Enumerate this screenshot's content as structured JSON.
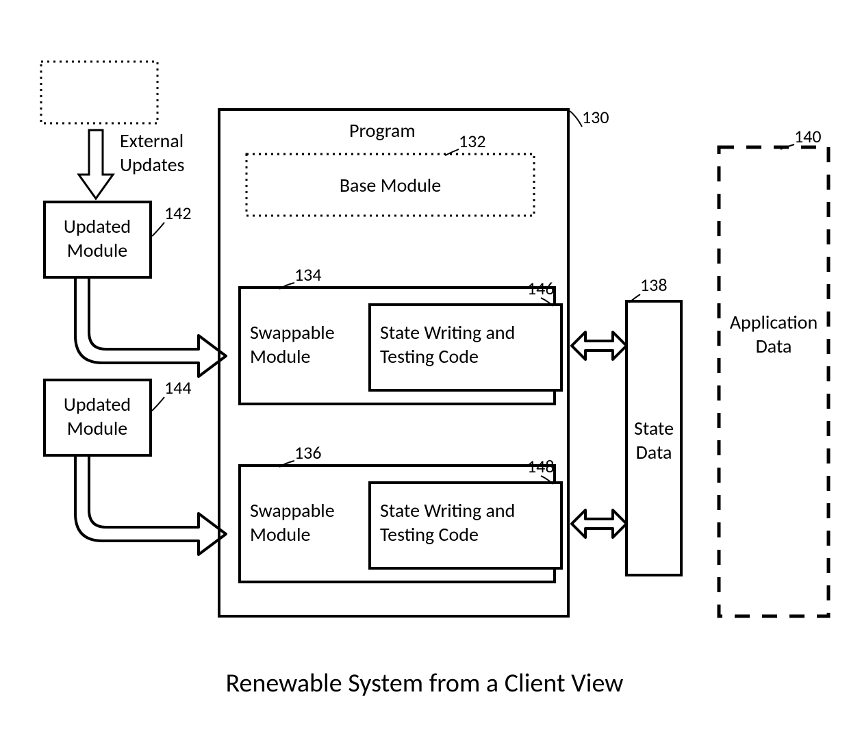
{
  "caption": "Renewable System from a Client View",
  "external_updates_label_line1": "External",
  "external_updates_label_line2": "Updates",
  "updated_module1": {
    "line1": "Updated",
    "line2": "Module",
    "ref": "142"
  },
  "updated_module2": {
    "line1": "Updated",
    "line2": "Module",
    "ref": "144"
  },
  "program": {
    "title": "Program",
    "ref": "130",
    "base_module": {
      "label": "Base Module",
      "ref": "132"
    },
    "swap1": {
      "ref": "134",
      "line1": "Swappable",
      "line2": "Module",
      "code_ref": "146",
      "code_line1": "State Writing and",
      "code_line2": "Testing Code"
    },
    "swap2": {
      "ref": "136",
      "line1": "Swappable",
      "line2": "Module",
      "code_ref": "148",
      "code_line1": "State Writing and",
      "code_line2": "Testing Code"
    }
  },
  "state_data": {
    "line1": "State",
    "line2": "Data",
    "ref": "138"
  },
  "app_data": {
    "line1": "Application",
    "line2": "Data",
    "ref": "140"
  }
}
